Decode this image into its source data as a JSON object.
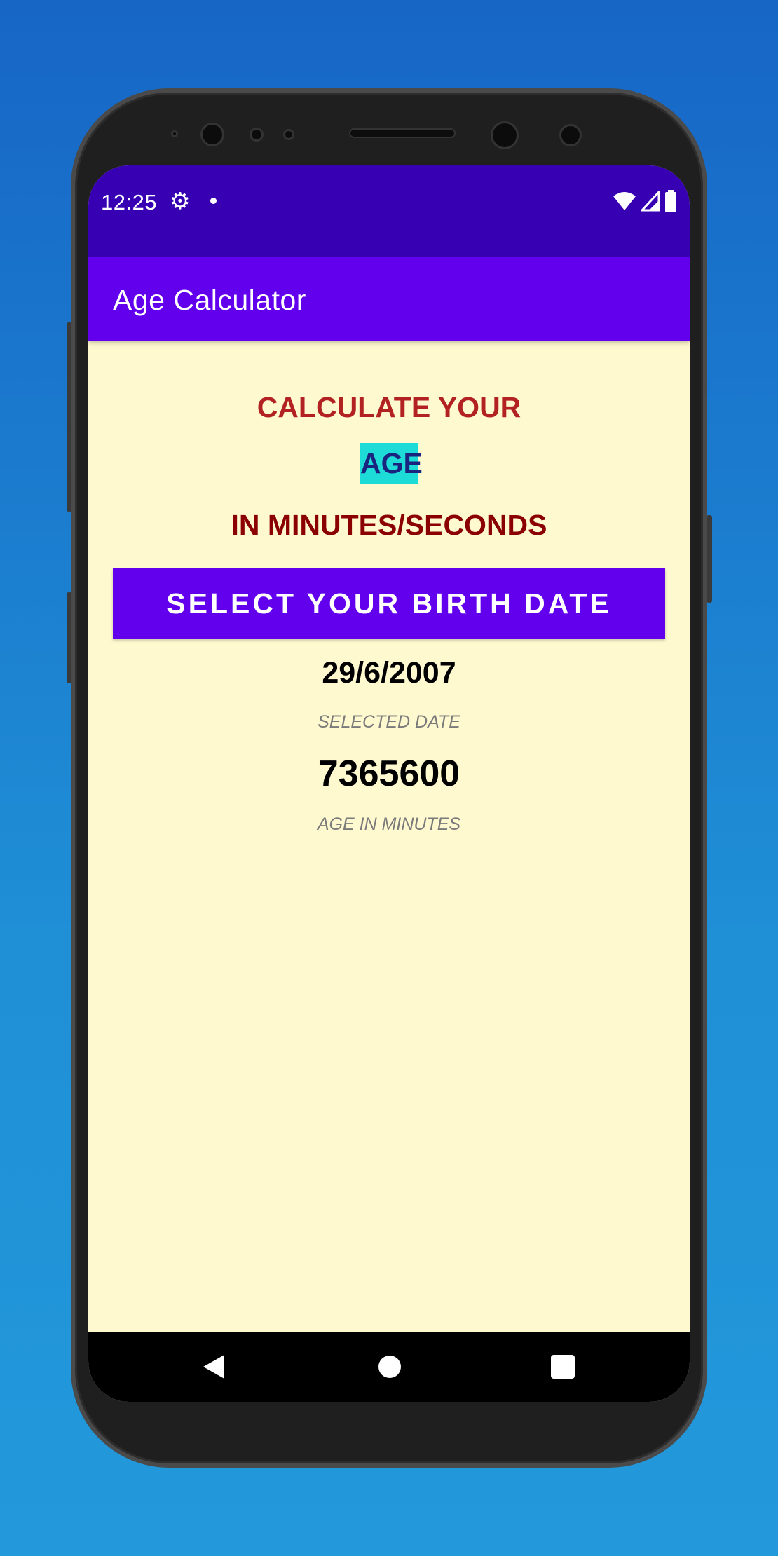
{
  "status_bar": {
    "time": "12:25",
    "icons": [
      "gear-icon",
      "notification-dot-icon",
      "wifi-icon",
      "cellular-signal-icon",
      "battery-icon"
    ]
  },
  "app_bar": {
    "title": "Age Calculator"
  },
  "heading": {
    "line1": "CALCULATE YOUR",
    "line2": "AGE",
    "line3": "IN MINUTES/SECONDS"
  },
  "select_button": {
    "label": "SELECT YOUR BIRTH DATE"
  },
  "result": {
    "selected_date": "29/6/2007",
    "selected_date_label": "SELECTED DATE",
    "age_in_minutes": "7365600",
    "age_in_minutes_label": "AGE IN MINUTES"
  },
  "colors": {
    "status_bar": "#3700b3",
    "app_bar": "#6200ee",
    "background": "#fff9d0",
    "heading_red": "#b22222",
    "heading_dark_red": "#8b0000",
    "age_highlight": "#1ddcd8",
    "age_text": "#1a237e"
  },
  "nav_bar": {
    "icons": [
      "back-icon",
      "home-icon",
      "recent-apps-icon"
    ]
  }
}
